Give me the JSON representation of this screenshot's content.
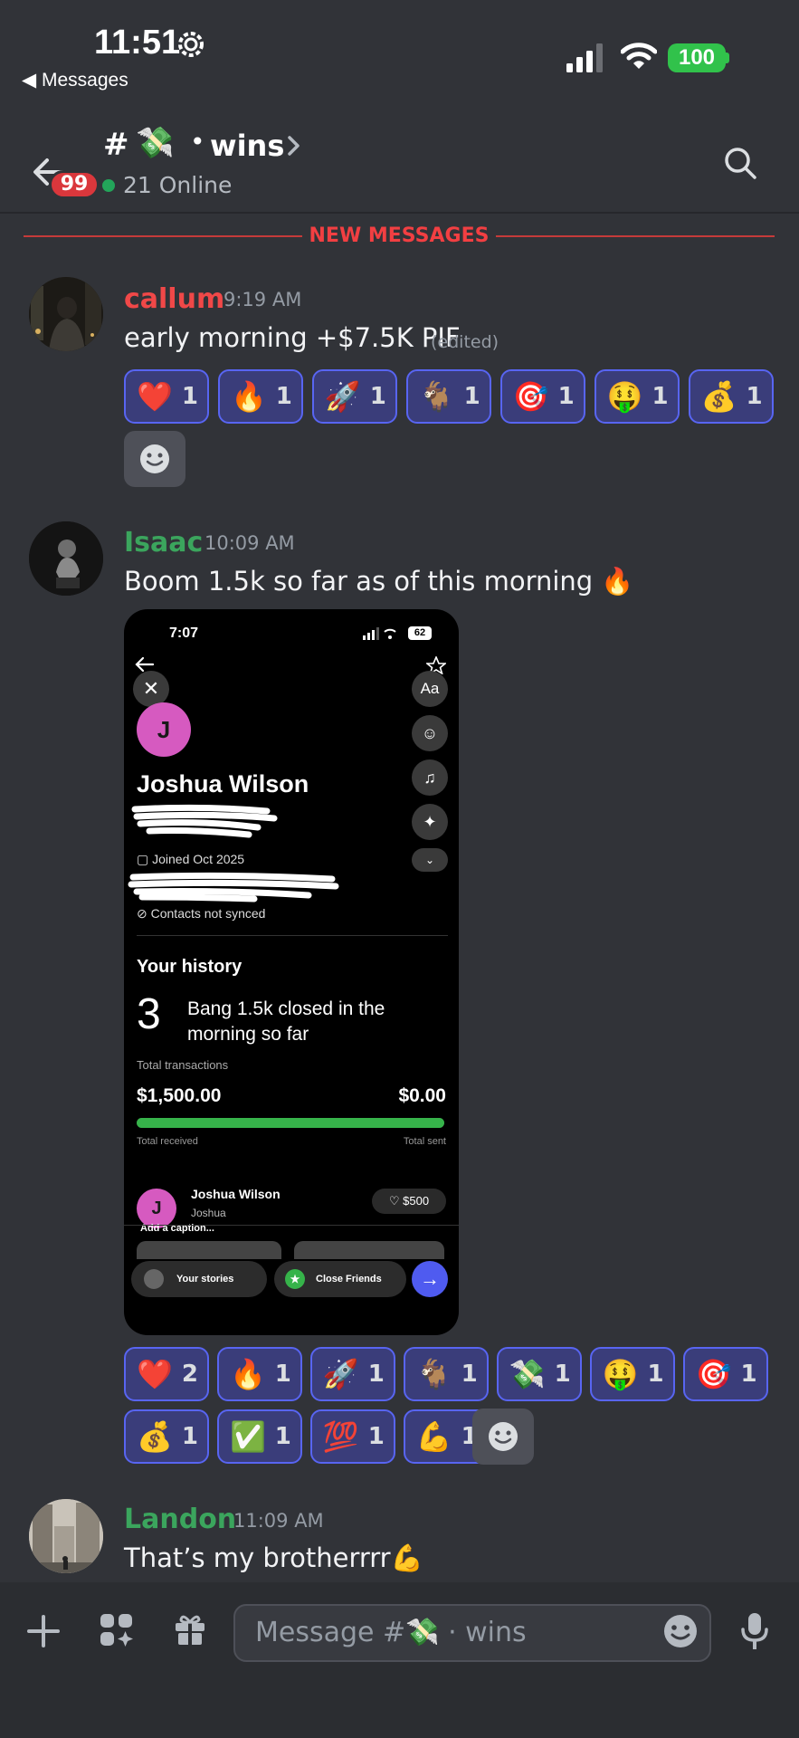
{
  "status_bar": {
    "time": "11:51",
    "back_app": "◀ Messages",
    "battery": "100"
  },
  "header": {
    "channel_hash": "#",
    "channel_emoji": "💸",
    "channel_separator": "•",
    "channel_name": "wins",
    "online_text": "21 Online",
    "unread_badge": "99"
  },
  "divider": {
    "label": "NEW MESSAGES"
  },
  "messages": [
    {
      "author": "callum",
      "author_color": "#f04848",
      "timestamp": "9:19 AM",
      "text": "early morning +$7.5K PIF",
      "edited": "(edited)",
      "reactions": [
        {
          "emoji": "❤️",
          "count": "1"
        },
        {
          "emoji": "🔥",
          "count": "1"
        },
        {
          "emoji": "🚀",
          "count": "1"
        },
        {
          "emoji": "🐐",
          "count": "1"
        },
        {
          "emoji": "🎯",
          "count": "1"
        },
        {
          "emoji": "🤑",
          "count": "1"
        },
        {
          "emoji": "💰",
          "count": "1"
        }
      ]
    },
    {
      "author": "Isaac",
      "author_color": "#3ba55d",
      "timestamp": "10:09 AM",
      "text": "Boom 1.5k so far as of this morning 🔥",
      "reactions": [
        {
          "emoji": "❤️",
          "count": "2"
        },
        {
          "emoji": "🔥",
          "count": "1"
        },
        {
          "emoji": "🚀",
          "count": "1"
        },
        {
          "emoji": "🐐",
          "count": "1"
        },
        {
          "emoji": "💸",
          "count": "1"
        },
        {
          "emoji": "🤑",
          "count": "1"
        },
        {
          "emoji": "🎯",
          "count": "1"
        },
        {
          "emoji": "💰",
          "count": "1"
        },
        {
          "emoji": "✅",
          "count": "1"
        },
        {
          "emoji": "💯",
          "count": "1"
        },
        {
          "emoji": "💪",
          "count": "1"
        }
      ]
    },
    {
      "author": "Landon",
      "author_color": "#3ba55d",
      "timestamp": "11:09 AM",
      "text": "That’s my brotherrrr💪"
    }
  ],
  "attachment": {
    "time": "7:07",
    "battery": "62",
    "avatar_letter": "J",
    "profile_name": "Joshua Wilson",
    "joined": "Joined Oct 2025",
    "contacts": "Contacts not synced",
    "history_title": "Your history",
    "count": "3",
    "caption": "Bang 1.5k closed in the morning so far",
    "total_label": "Total transactions",
    "received_amount": "$1,500.00",
    "sent_amount": "$0.00",
    "received_label": "Total received",
    "sent_label": "Total sent",
    "received_fraction": 1.0,
    "tx_name": "Joshua Wilson",
    "tx_sub": "Joshua",
    "tx_amount": "♡ $500",
    "add_caption": "Add a caption...",
    "your_stories": "Your stories",
    "close_friends": "Close Friends",
    "side_aa": "Aa"
  },
  "input": {
    "placeholder_prefix": "Message #",
    "placeholder_emoji": "💸",
    "placeholder_suffix": "· wins"
  },
  "icons": [
    "gear-icon",
    "signal-icon",
    "wifi-icon",
    "back-arrow-icon",
    "chevron-right-icon",
    "search-icon",
    "add-reaction-icon",
    "plus-icon",
    "apps-icon",
    "gift-icon",
    "emoji-icon",
    "mic-icon"
  ],
  "colors": {
    "background": "#313338",
    "accent": "#5865f2",
    "new_messages": "#f23f42",
    "online": "#23a55a"
  }
}
